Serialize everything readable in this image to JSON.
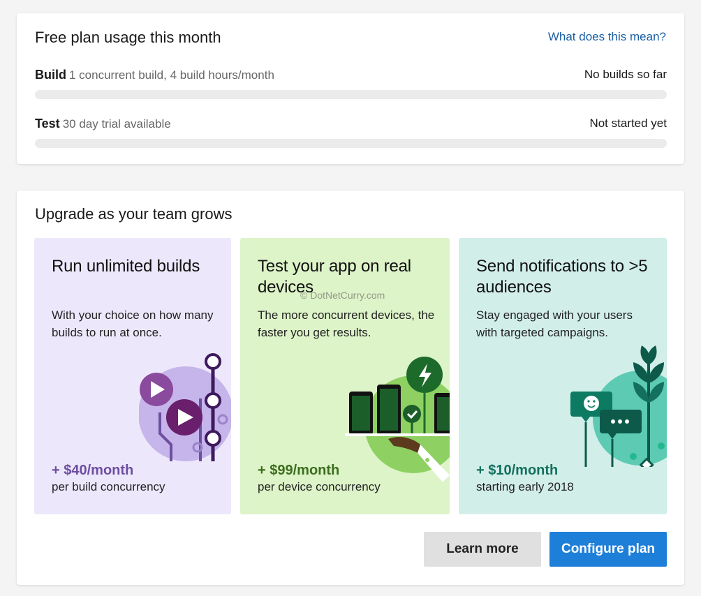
{
  "usage": {
    "title": "Free plan usage this month",
    "help_link": "What does this mean?",
    "rows": [
      {
        "name": "Build",
        "desc": "1 concurrent build, 4 build hours/month",
        "status": "No builds so far",
        "progress": 0
      },
      {
        "name": "Test",
        "desc": "30 day trial available",
        "status": "Not started yet",
        "progress": 0
      }
    ]
  },
  "upgrade": {
    "title": "Upgrade as your team grows",
    "plans": [
      {
        "title": "Run unlimited builds",
        "desc": "With your choice on how many builds to run at once.",
        "price": "+ $40/month",
        "note": "per build concurrency",
        "icon": "build-play-illustration",
        "color": "#6c4fa0"
      },
      {
        "title": "Test your app on real devices",
        "desc": "The more concurrent devices, the faster you get results.",
        "price": "+ $99/month",
        "note": "per device concurrency",
        "icon": "device-test-illustration",
        "color": "#3b6e1d"
      },
      {
        "title": "Send notifications to >5 audiences",
        "desc": "Stay engaged with your users with targeted campaigns.",
        "price": "+ $10/month",
        "note": "starting early 2018",
        "icon": "notification-chat-illustration",
        "color": "#13705f"
      }
    ],
    "learn_more": "Learn more",
    "configure": "Configure plan"
  },
  "watermark": "© DotNetCurry.com"
}
